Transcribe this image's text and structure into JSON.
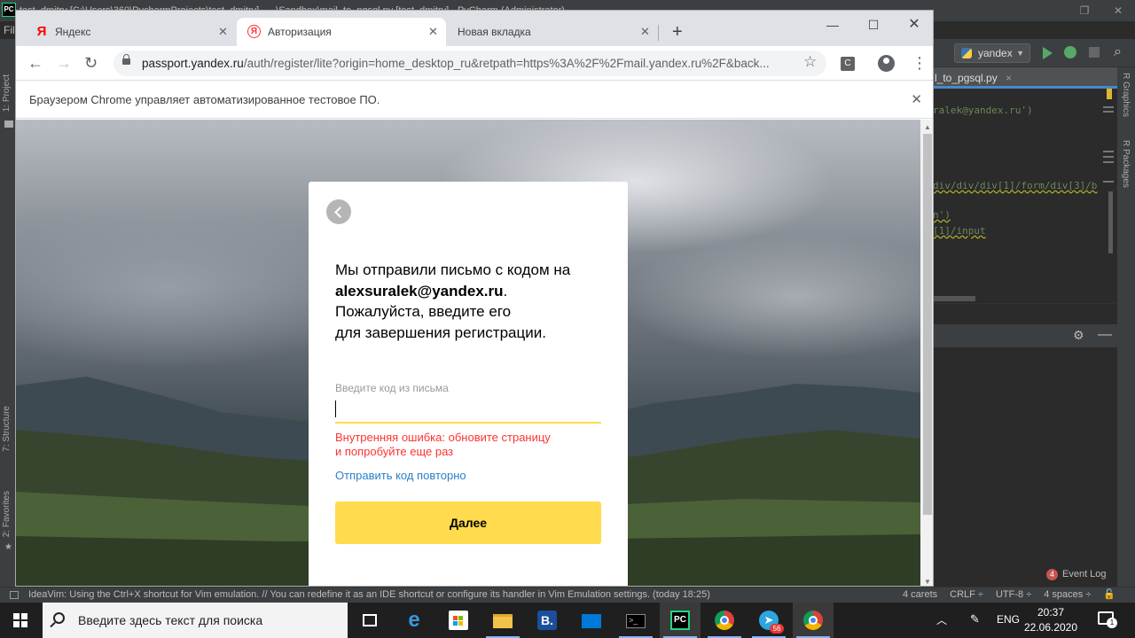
{
  "ide": {
    "logo": "PC",
    "title_text": "test_dmitry [C:\\Users\\360\\PycharmProjects\\test_dmitry] - ...\\Sandbox\\mail_to_pgsql.py [test_dmitry] - PyCharm (Administrator)",
    "menu_label": "Fil",
    "run_config": "yandex",
    "file_tab": "l_to_pgsql.py",
    "code_lines": [
      "ralek@yandex.ru')",
      "div/div/div[1]/form/div[3]/b",
      "n')",
      "[1]/input"
    ],
    "left_labels": {
      "project": "1: Project",
      "structure": "7: Structure",
      "favorites": "2: Favorites"
    },
    "right_labels": {
      "graphics": "R Graphics",
      "packages": "R Packages"
    },
    "event_log": "Event Log",
    "event_count": "4",
    "status_message": "IdeaVim: Using the Ctrl+X shortcut for Vim emulation. // You can redefine it as an IDE shortcut or configure its handler in Vim Emulation settings. (today 18:25)",
    "status_right": [
      "4 carets",
      "CRLF ÷",
      "UTF-8 ÷",
      "4 spaces ÷"
    ]
  },
  "browser": {
    "tabs": [
      {
        "label": "Яндекс",
        "favicon": "Я"
      },
      {
        "label": "Авторизация",
        "favicon": "Я"
      },
      {
        "label": "Новая вкладка",
        "favicon": ""
      }
    ],
    "url_host": "passport.yandex.ru",
    "url_path": "/auth/register/lite?origin=home_desktop_ru&retpath=https%3A%2F%2Fmail.yandex.ru%2F&back...",
    "extension_label": "C",
    "infobar": "Браузером Chrome управляет автоматизированное тестовое ПО."
  },
  "card": {
    "msg_line1": "Мы отправили письмо с кодом на",
    "email": "alexsuralek@yandex.ru",
    "email_suffix": ".",
    "msg_line3": "Пожалуйста, введите его",
    "msg_line4": "для завершения регистрации.",
    "code_label": "Введите код из письма",
    "code_value": "",
    "error_line1": "Внутренняя ошибка: обновите страницу",
    "error_line2": "и попробуйте еще раз",
    "resend": "Отправить код повторно",
    "next_button": "Далее"
  },
  "taskbar": {
    "search_placeholder": "Введите здесь текст для поиска",
    "lang": "ENG",
    "time": "20:37",
    "date": "22.06.2020",
    "telegram_badge": "56",
    "notification_count": "1"
  },
  "colors": {
    "yandex_yellow": "#ffdb4d",
    "error_red": "#ff3333",
    "link_blue": "#2a7fc9",
    "ide_bg": "#2b2b2b"
  }
}
